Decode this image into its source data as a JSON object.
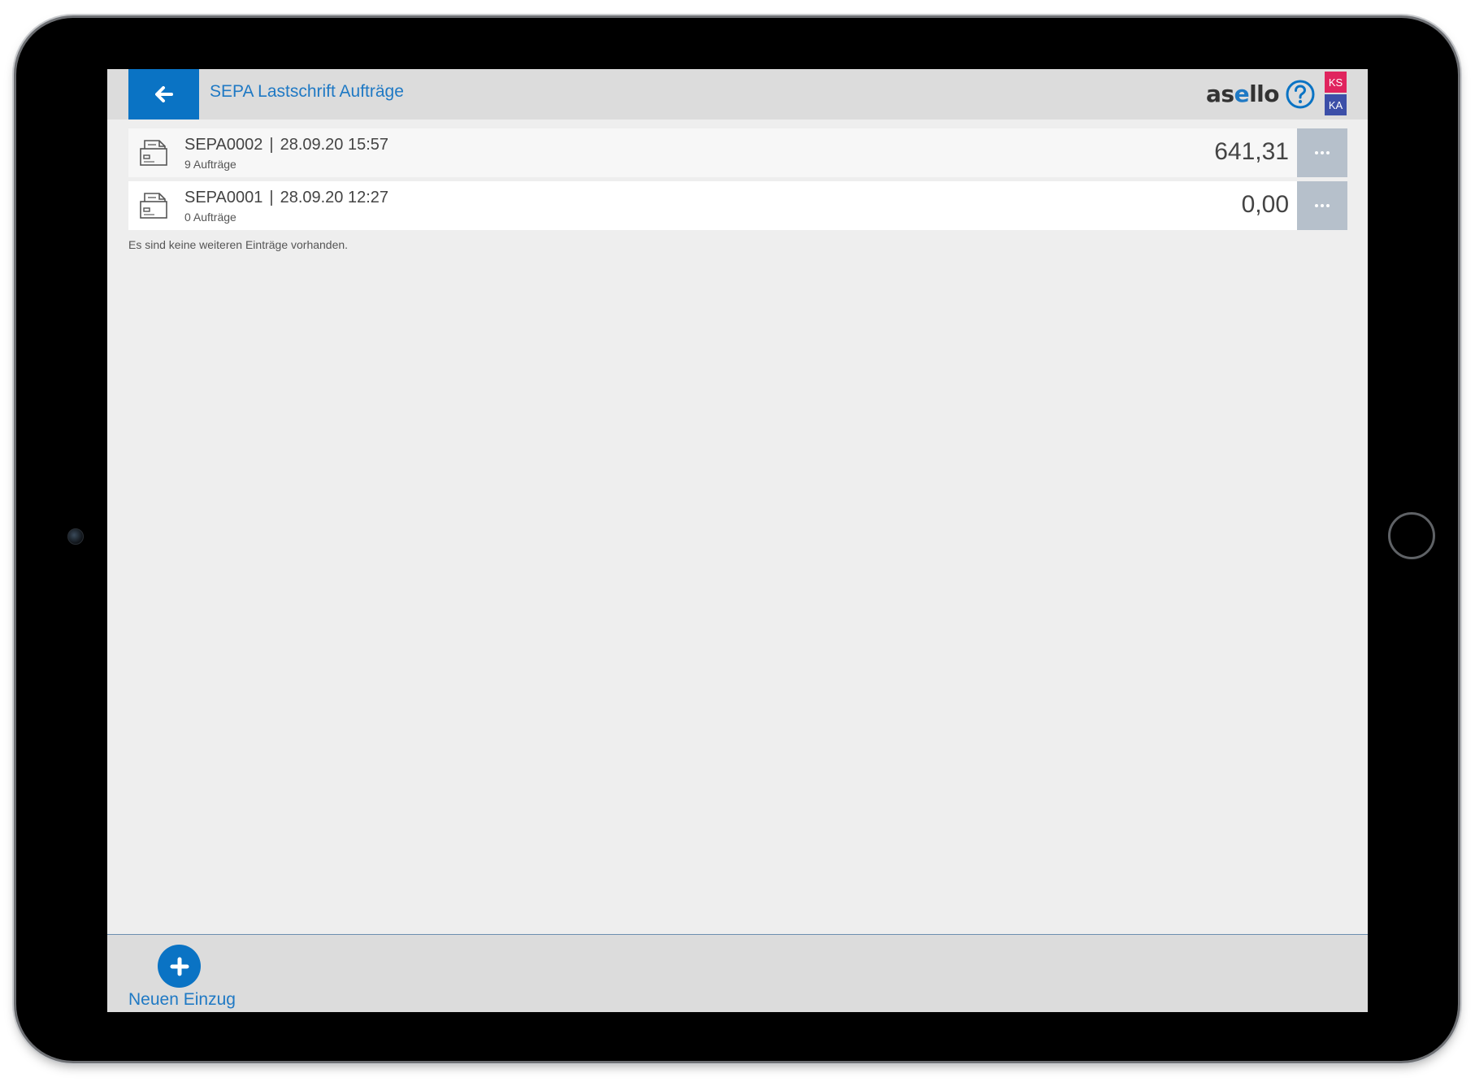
{
  "header": {
    "title": "SEPA Lastschrift Aufträge",
    "brand_prefix": "as",
    "brand_accent": "e",
    "brand_suffix": "llo",
    "badges": [
      "KS",
      "KA"
    ]
  },
  "list": {
    "items": [
      {
        "id": "SEPA0002",
        "separator": "|",
        "datetime": "28.09.20 15:57",
        "subtitle": "9 Aufträge",
        "amount": "641,31",
        "icon": "sepa-document-icon"
      },
      {
        "id": "SEPA0001",
        "separator": "|",
        "datetime": "28.09.20 12:27",
        "subtitle": "0 Aufträge",
        "amount": "0,00",
        "icon": "sepa-document-icon"
      }
    ],
    "empty_note": "Es sind keine weiteren Einträge vorhanden."
  },
  "footer": {
    "new_entry_label": "Neuen Einzug"
  },
  "icons": {
    "back": "arrow-left-icon",
    "help": "question-circle-icon",
    "more": "more-dots-icon",
    "add": "plus-icon"
  },
  "colors": {
    "accent": "#0a73c4",
    "badge_ks": "#e0245e",
    "badge_ka": "#3c4fa8",
    "more_button": "#b6c0cb"
  }
}
